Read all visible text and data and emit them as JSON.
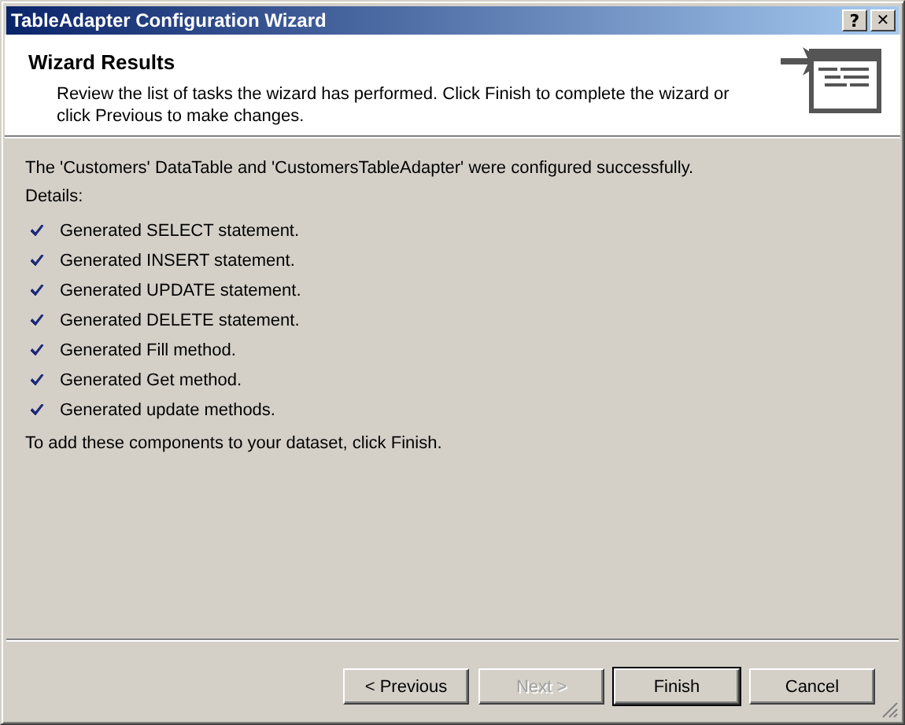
{
  "window": {
    "title": "TableAdapter Configuration Wizard",
    "title_buttons": [
      {
        "kind": "help",
        "label": "?"
      },
      {
        "kind": "close",
        "label": "✕"
      }
    ]
  },
  "header": {
    "title": "Wizard Results",
    "description": "Review the list of tasks the wizard has performed. Click Finish to complete the wizard or click Previous to make changes."
  },
  "summary": "The 'Customers' DataTable and 'CustomersTableAdapter' were configured successfully.",
  "details_label": "Details:",
  "tasks": [
    {
      "text": "Generated SELECT statement.",
      "done": true
    },
    {
      "text": "Generated INSERT statement.",
      "done": true
    },
    {
      "text": "Generated UPDATE statement.",
      "done": true
    },
    {
      "text": "Generated DELETE statement.",
      "done": true
    },
    {
      "text": "Generated Fill method.",
      "done": true
    },
    {
      "text": "Generated Get method.",
      "done": true
    },
    {
      "text": "Generated update methods.",
      "done": true
    }
  ],
  "footer_note": "To add these components to your dataset, click Finish.",
  "buttons": [
    {
      "label": "< Previous",
      "disabled": false,
      "default": false
    },
    {
      "label": "Next >",
      "disabled": true,
      "default": false
    },
    {
      "label": "Finish",
      "disabled": false,
      "default": true
    },
    {
      "label": "Cancel",
      "disabled": false,
      "default": false
    }
  ]
}
